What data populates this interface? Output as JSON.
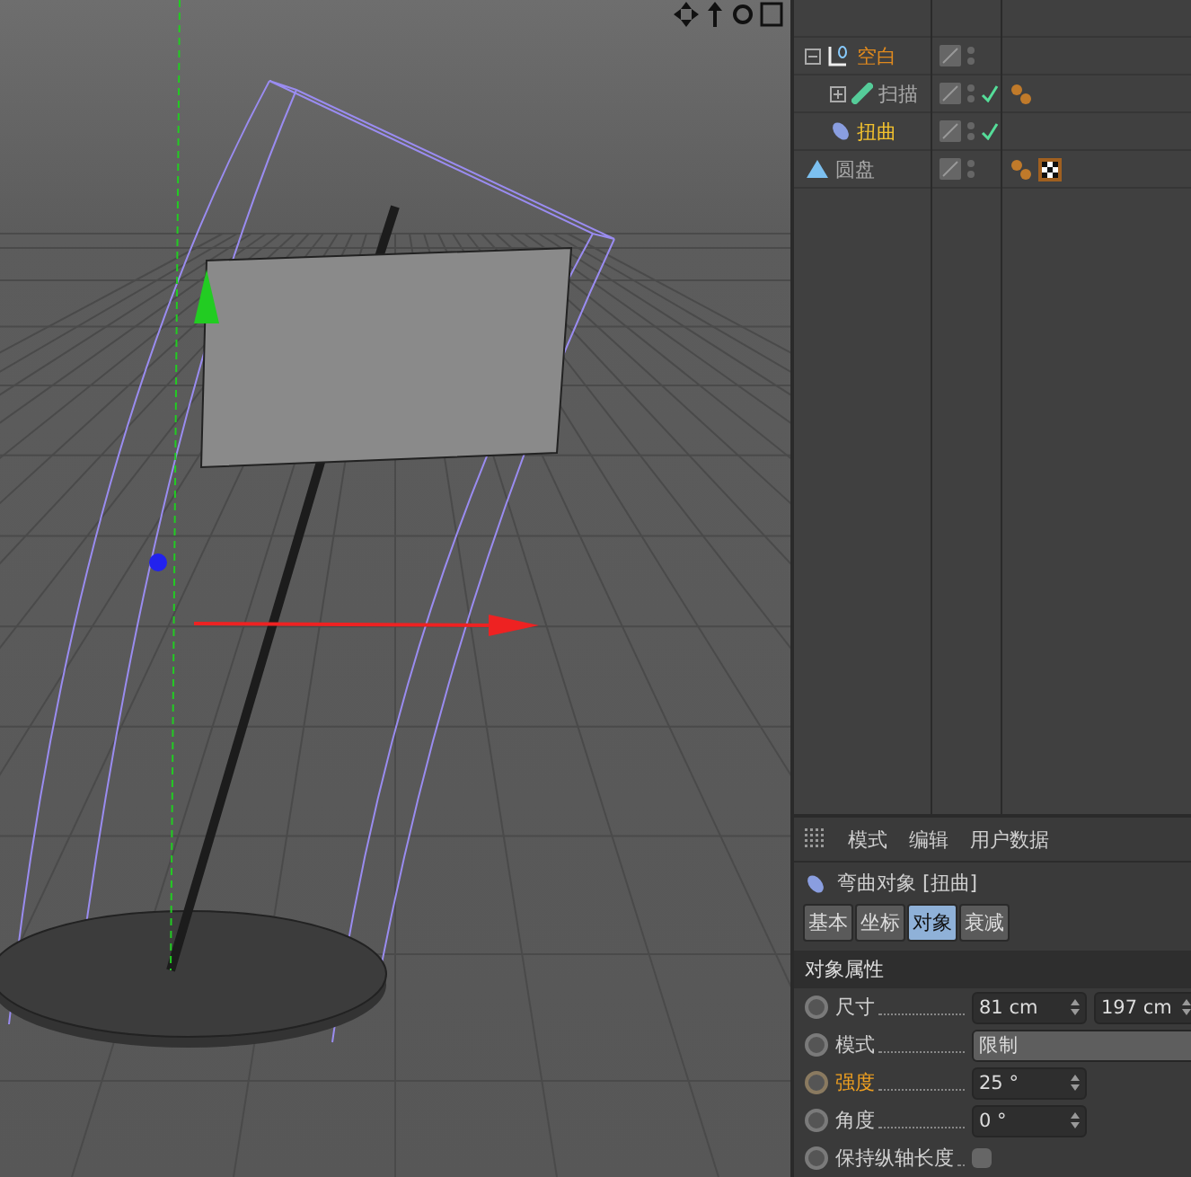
{
  "objects": [
    {
      "name": "空白",
      "color": "#e08a1e",
      "kind": "null",
      "expanded": true,
      "enabled": false,
      "children": [
        {
          "name": "扫描",
          "color": "#a8a8a8",
          "kind": "sweep",
          "expanded": false,
          "enabled": true,
          "tags": [
            {
              "kind": "material"
            }
          ]
        },
        {
          "name": "扭曲",
          "color": "#f2c12e",
          "kind": "bend",
          "enabled": true
        }
      ]
    },
    {
      "name": "圆盘",
      "color": "#a8a8a8",
      "kind": "disc",
      "enabled": false,
      "tags": [
        {
          "kind": "material"
        },
        {
          "kind": "checker"
        }
      ]
    }
  ],
  "attributes": {
    "menu": [
      "模式",
      "编辑",
      "用户数据"
    ],
    "title": "弯曲对象 [扭曲]",
    "tabs": [
      {
        "label": "基本",
        "selected": false
      },
      {
        "label": "坐标",
        "selected": false
      },
      {
        "label": "对象",
        "selected": true
      },
      {
        "label": "衰减",
        "selected": false
      }
    ],
    "section": "对象属性",
    "fields": [
      {
        "kind": "numbers",
        "label": "尺寸",
        "animated": false,
        "values": [
          "81 cm",
          "197 cm"
        ]
      },
      {
        "kind": "dropdown",
        "label": "模式",
        "animated": false,
        "values": [
          "限制"
        ]
      },
      {
        "kind": "numbers",
        "label": "强度",
        "animated": true,
        "values": [
          "25 °"
        ]
      },
      {
        "kind": "numbers",
        "label": "角度",
        "animated": false,
        "values": [
          "0 °"
        ]
      },
      {
        "kind": "checkbox",
        "label": "保持纵轴长度",
        "animated": false,
        "checked": false
      }
    ]
  }
}
